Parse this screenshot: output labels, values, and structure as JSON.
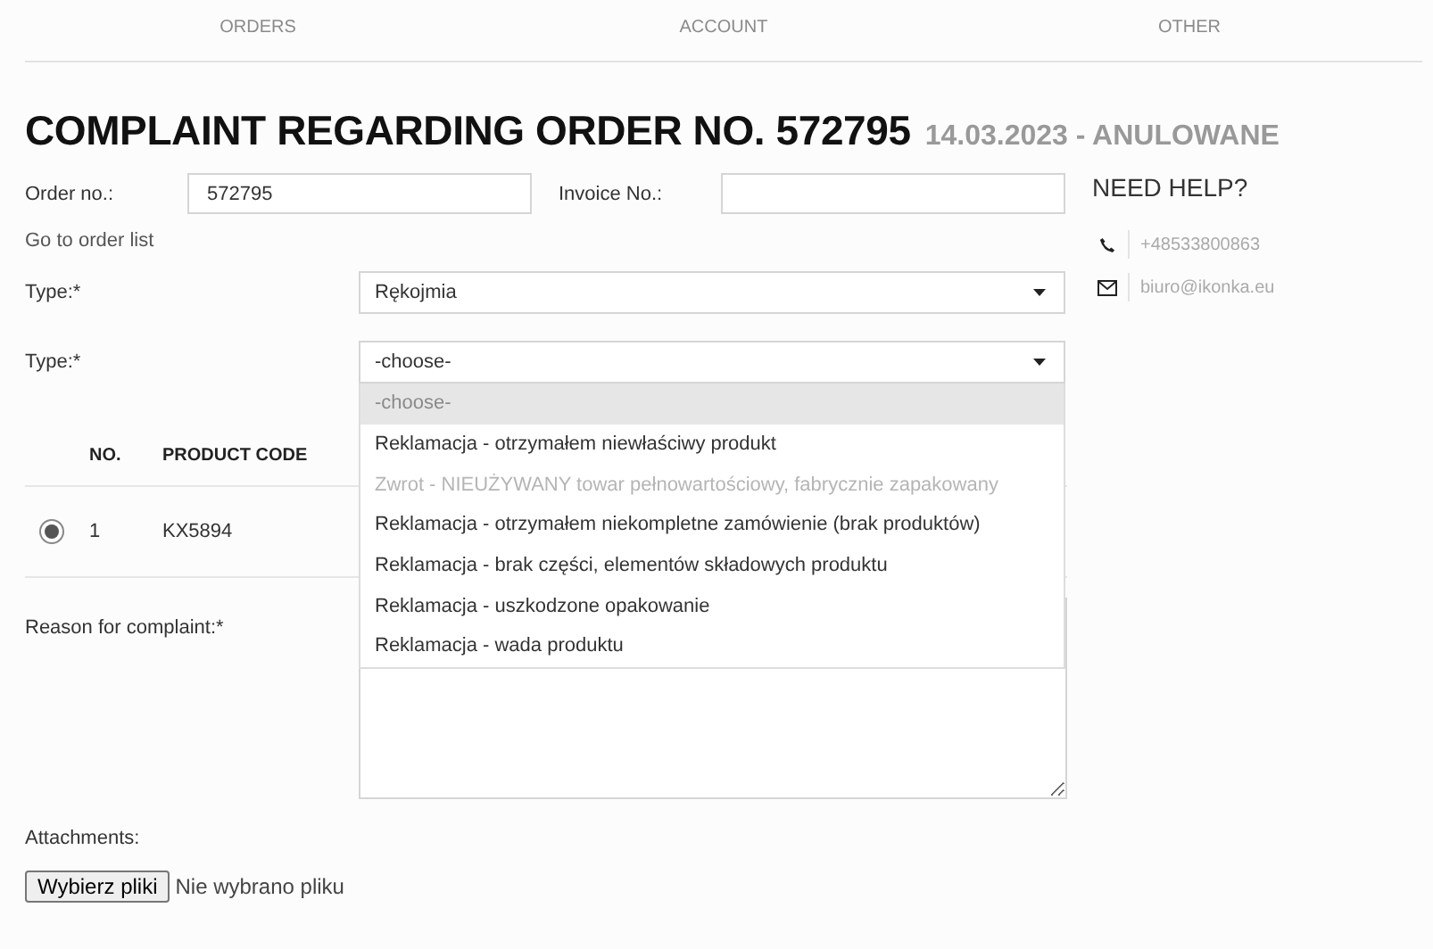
{
  "nav": {
    "items": [
      "ORDERS",
      "ACCOUNT",
      "OTHER"
    ]
  },
  "heading": {
    "title": "COMPLAINT REGARDING ORDER NO. 572795",
    "subtitle": "14.03.2023 - ANULOWANE"
  },
  "form": {
    "order_no": {
      "label": "Order no.:",
      "value": "572795"
    },
    "invoice_no": {
      "label": "Invoice No.:"
    },
    "order_list_link": "Go to order list",
    "type_select": {
      "label": "Type:*",
      "value": "Rękojmia"
    },
    "subtype_select": {
      "label": "Type:*",
      "value": "-choose-",
      "expanded": true,
      "options": [
        {
          "label": "-choose-",
          "selected": true,
          "disabled": true
        },
        {
          "label": "Reklamacja - otrzymałem niewłaściwy produkt",
          "selected": false,
          "disabled": false
        },
        {
          "label": "Zwrot - NIEUŻYWANY towar pełnowartościowy, fabrycznie zapakowany",
          "selected": false,
          "disabled": true
        },
        {
          "label": "Reklamacja - otrzymałem niekompletne zamówienie (brak produktów)",
          "selected": false,
          "disabled": false
        },
        {
          "label": "Reklamacja - brak części, elementów składowych produktu",
          "selected": false,
          "disabled": false
        },
        {
          "label": "Reklamacja - uszkodzone opakowanie",
          "selected": false,
          "disabled": false
        },
        {
          "label": "Reklamacja - wada produktu",
          "selected": false,
          "disabled": false
        }
      ]
    },
    "products": {
      "columns": [
        "NO.",
        "PRODUCT CODE"
      ],
      "rows": [
        {
          "selected": true,
          "no": "1",
          "code": "KX5894"
        }
      ]
    },
    "reason": {
      "label": "Reason for complaint:*"
    },
    "attachments": {
      "label": "Attachments:",
      "button": "Wybierz pliki",
      "status": "Nie wybrano pliku"
    }
  },
  "help": {
    "title": "NEED HELP?",
    "contacts": [
      {
        "kind": "phone",
        "text": "+48533800863"
      },
      {
        "kind": "email",
        "text": "biuro@ikonka.eu"
      }
    ]
  }
}
